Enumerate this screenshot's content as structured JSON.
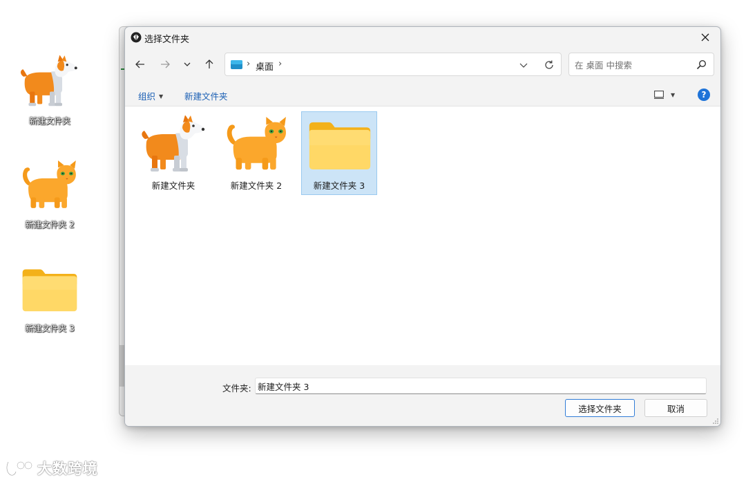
{
  "desktop": {
    "items": [
      {
        "label": "新建文件夹",
        "icon": "corgi-folder-icon"
      },
      {
        "label": "新建文件夹 2",
        "icon": "cat-folder-icon"
      },
      {
        "label": "新建文件夹 3",
        "icon": "folder-icon"
      }
    ]
  },
  "dialog": {
    "title": "选择文件夹",
    "address": {
      "location_icon": "desktop-icon",
      "crumb": "桌面",
      "separator": "›"
    },
    "search": {
      "placeholder": "在 桌面 中搜索"
    },
    "commandbar": {
      "organize": "组织",
      "new_folder": "新建文件夹",
      "help": "?"
    },
    "files": [
      {
        "label": "新建文件夹",
        "icon": "corgi-folder-icon",
        "selected": false
      },
      {
        "label": "新建文件夹 2",
        "icon": "cat-folder-icon",
        "selected": false
      },
      {
        "label": "新建文件夹 3",
        "icon": "folder-icon",
        "selected": true
      }
    ],
    "footer": {
      "folder_label": "文件夹:",
      "folder_value": "新建文件夹 3",
      "select_button": "选择文件夹",
      "cancel_button": "取消"
    }
  },
  "watermark": {
    "text": "大数跨境"
  },
  "colors": {
    "accent": "#1a5fb4",
    "selection": "#cce4f7",
    "folder": "#ffca28",
    "help": "#1e73d8"
  }
}
